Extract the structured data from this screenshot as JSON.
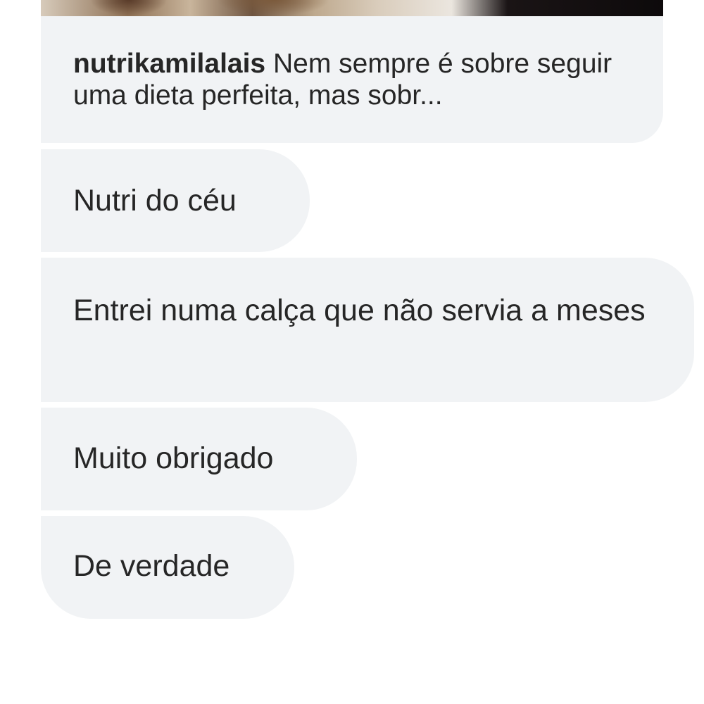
{
  "shared_post": {
    "author": "nutrikamilalais",
    "caption": " Nem sempre é sobre seguir uma dieta perfeita, mas sobr..."
  },
  "messages": [
    {
      "text": "Nutri do céu"
    },
    {
      "text": "Entrei numa calça que não servia a meses"
    },
    {
      "text": "Muito obrigado"
    },
    {
      "text": "De verdade"
    }
  ],
  "colors": {
    "bubble_background": "#f1f3f5",
    "text": "#262626",
    "page_background": "#ffffff"
  }
}
